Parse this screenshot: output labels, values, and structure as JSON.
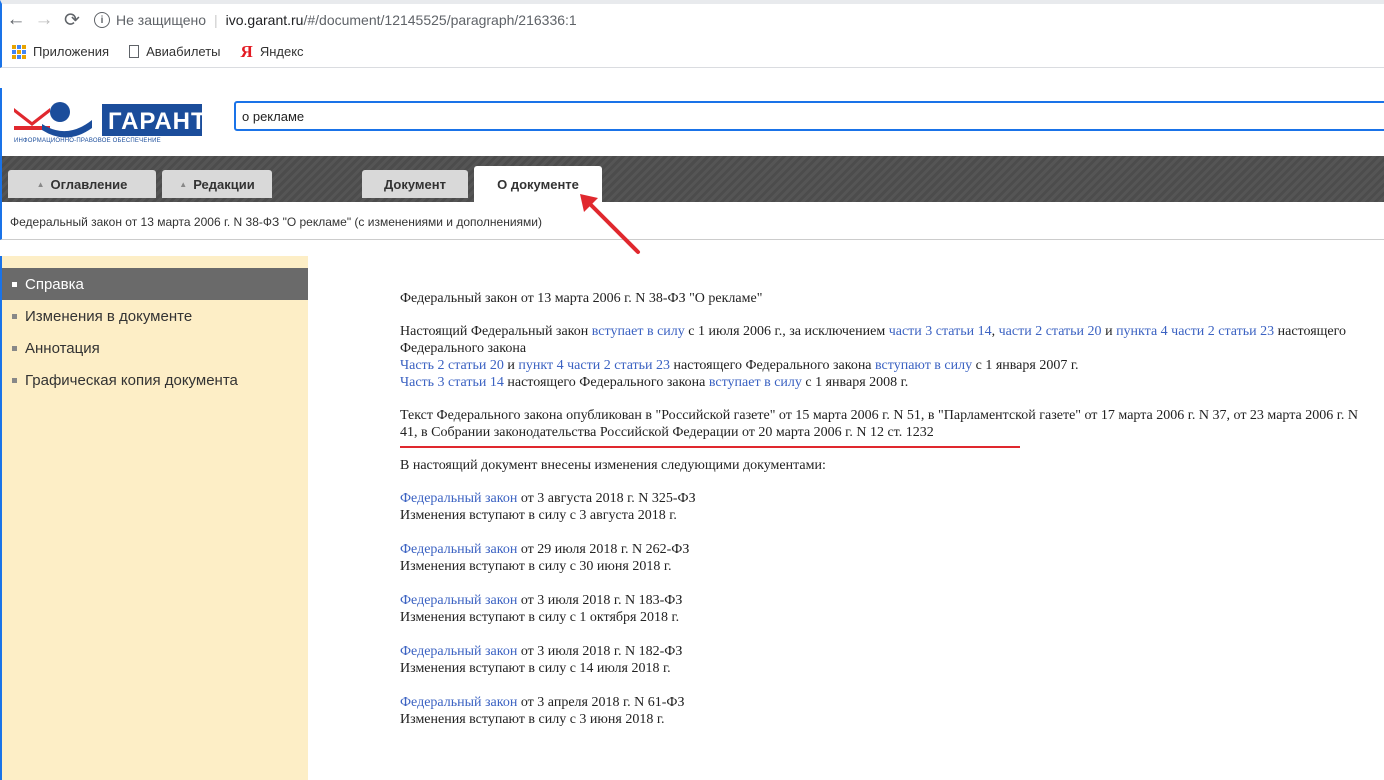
{
  "browser": {
    "security_label": "Не защищено",
    "url_host": "ivo.garant.ru",
    "url_path": "/#/document/12145525/paragraph/216336:1",
    "bookmarks": [
      {
        "label": "Приложения",
        "icon": "apps-icon"
      },
      {
        "label": "Авиабилеты",
        "icon": "doc-icon"
      },
      {
        "label": "Яндекс",
        "icon": "yandex-icon"
      }
    ]
  },
  "header": {
    "logo_subtitle": "ИНФОРМАЦИОННО-ПРАВОВОЕ ОБЕСПЕЧЕНИЕ",
    "search_value": "о рекламе"
  },
  "tabs": [
    {
      "label": "Оглавление",
      "has_arrow": true
    },
    {
      "label": "Редакции",
      "has_arrow": true
    },
    {
      "label": "Документ",
      "has_arrow": false
    },
    {
      "label": "О документе",
      "has_arrow": false,
      "active": true
    }
  ],
  "doc_title": "Федеральный закон от 13 марта 2006 г. N 38-ФЗ \"О рекламе\" (с изменениями и дополнениями)",
  "sidebar": {
    "items": [
      {
        "label": "Справка",
        "active": true
      },
      {
        "label": "Изменения в документе"
      },
      {
        "label": "Аннотация"
      },
      {
        "label": "Графическая копия документа"
      }
    ]
  },
  "content": {
    "heading": "Федеральный закон от 13 марта 2006 г. N 38-ФЗ \"О рекламе\"",
    "p1": {
      "t1": "Настоящий Федеральный закон ",
      "l1": "вступает в силу",
      "t2": " с 1 июля 2006 г., за исключением ",
      "l2": "части 3 статьи 14",
      "t3": ", ",
      "l3": "части 2 статьи 20",
      "t4": " и ",
      "l4": "пункта 4 части 2 статьи 23",
      "t5": " настоящего Федерального закона"
    },
    "p1b": {
      "l1": "Часть 2 статьи 20",
      "t1": " и ",
      "l2": "пункт 4 части 2 статьи 23",
      "t2": " настоящего Федерального закона ",
      "l3": "вступают в силу",
      "t3": " с 1 января 2007 г."
    },
    "p1c": {
      "l1": "Часть 3 статьи 14",
      "t1": " настоящего Федерального закона ",
      "l2": "вступает в силу",
      "t2": " с 1 января 2008 г."
    },
    "p2": "Текст Федерального закона опубликован в \"Российской газете\" от 15 марта 2006 г. N 51, в \"Парламентской газете\" от 17 марта 2006 г. N 37, от 23 марта 2006 г. N 41, в Собрании законодательства Российской Федерации от 20 марта 2006 г. N 12 ст. 1232",
    "p3": "В настоящий документ внесены изменения следующими документами:",
    "changes": [
      {
        "link": "Федеральный закон",
        "rest": " от 3 августа 2018 г. N 325-ФЗ",
        "effect": "Изменения вступают в силу с 3 августа 2018 г."
      },
      {
        "link": "Федеральный закон",
        "rest": " от 29 июля 2018 г. N 262-ФЗ",
        "effect": "Изменения вступают в силу с 30 июня 2018 г."
      },
      {
        "link": "Федеральный закон",
        "rest": " от 3 июля 2018 г. N 183-ФЗ",
        "effect": "Изменения вступают в силу с 1 октября 2018 г."
      },
      {
        "link": "Федеральный закон",
        "rest": " от 3 июля 2018 г. N 182-ФЗ",
        "effect": "Изменения вступают в силу с 14 июля 2018 г."
      },
      {
        "link": "Федеральный закон",
        "rest": " от 3 апреля 2018 г. N 61-ФЗ",
        "effect": "Изменения вступают в силу с 3 июня 2018 г."
      }
    ]
  },
  "colors": {
    "link": "#3b62c2",
    "sidebar_bg": "#fdeec6",
    "sidebar_active": "#6a6a6a",
    "annotation_red": "#e0282e",
    "focus_blue": "#1a73e8"
  }
}
